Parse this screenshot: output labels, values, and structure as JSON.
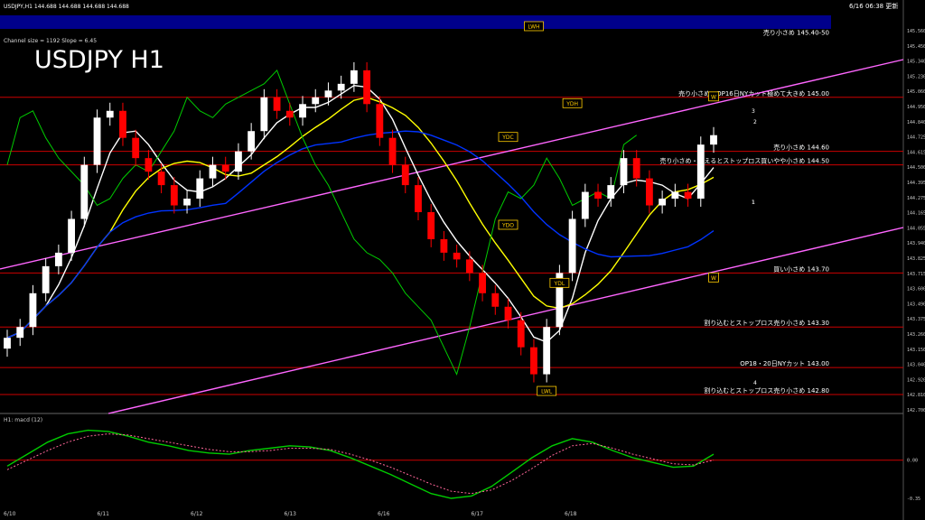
{
  "header": {
    "symbol_line": "USDJPY,H1  144.688 144.688 144.688 144.688",
    "timestamp": "6/16 06:38 更新",
    "channel_info": "Channel size = 1192 Slope = 6.45",
    "big_title": "USDJPY H1"
  },
  "colors": {
    "background": "#000000",
    "candle_up": "#ffffff",
    "candle_down": "#ff0000",
    "sma_fast": "#ffffff",
    "sma_mid": "#ffff00",
    "sma_slow": "#0033ff",
    "channel": "#ff66ff",
    "chikou": "#00cc00",
    "resistance_banner": "#00008b",
    "level_line": "#cc0000",
    "macd_line": "#00cc00",
    "macd_signal": "#ff6699"
  },
  "chart_data": {
    "type": "candlestick",
    "title": "USDJPY H1",
    "ylim": [
      142.7,
      145.56
    ],
    "y_ticks": [
      "145.560",
      "145.450",
      "145.340",
      "145.230",
      "145.060",
      "144.950",
      "144.840",
      "144.725",
      "144.615",
      "144.500",
      "144.395",
      "144.275",
      "144.165",
      "144.055",
      "143.940",
      "143.825",
      "143.715",
      "143.600",
      "143.490",
      "143.375",
      "143.260",
      "143.150",
      "143.040",
      "142.920",
      "142.810",
      "142.700"
    ],
    "x_labels": [
      "6/10",
      "6/11",
      "6/12",
      "6/13",
      "6/16",
      "6/17",
      "6/18"
    ],
    "close": [
      143.22,
      143.3,
      143.55,
      143.75,
      143.85,
      144.1,
      144.5,
      144.85,
      144.9,
      144.7,
      144.55,
      144.45,
      144.35,
      144.2,
      144.25,
      144.4,
      144.5,
      144.45,
      144.6,
      144.75,
      145.0,
      144.9,
      144.85,
      144.95,
      145.0,
      145.05,
      145.1,
      145.2,
      144.95,
      144.7,
      144.5,
      144.35,
      144.15,
      143.95,
      143.85,
      143.8,
      143.7,
      143.55,
      143.45,
      143.35,
      143.15,
      142.95,
      143.3,
      143.7,
      144.1,
      144.3,
      144.25,
      144.35,
      144.55,
      144.4,
      144.2,
      144.25,
      144.3,
      144.25,
      144.65,
      144.72
    ],
    "levels": [
      {
        "label": "売り小さめ 145.40-50",
        "value": 145.45
      },
      {
        "label": "売り小さめ、OP16日NYカット極めて大きめ 145.00",
        "value": 145.0
      },
      {
        "label": "売り小さめ 144.60",
        "value": 144.6
      },
      {
        "label": "売り小さめ・超えるとストップロス買いやや小さめ 144.50",
        "value": 144.5
      },
      {
        "label": "買い小さめ 143.70",
        "value": 143.7
      },
      {
        "label": "割り込むとストップロス売り小さめ 143.30",
        "value": 143.3
      },
      {
        "label": "OP18・20日NYカット 143.00",
        "value": 143.0
      },
      {
        "label": "割り込むとストップロス売り小さめ 142.80",
        "value": 142.8
      }
    ],
    "markers": [
      {
        "label": "LWH",
        "value": 145.52,
        "index": 41
      },
      {
        "label": "YDH",
        "value": 144.95,
        "index": 44
      },
      {
        "label": "YDC",
        "value": 144.7,
        "index": 39
      },
      {
        "label": "YDO",
        "value": 144.05,
        "index": 39
      },
      {
        "label": "YDL",
        "value": 143.62,
        "index": 43
      },
      {
        "label": "LWL",
        "value": 142.82,
        "index": 42
      },
      {
        "label": "W",
        "value": 145.0,
        "index": 55
      },
      {
        "label": "W",
        "value": 143.66,
        "index": 55
      }
    ],
    "channel_numbers": [
      "1",
      "2",
      "3",
      "4",
      "1"
    ],
    "macd": {
      "label": "H1: macd (12)",
      "y_ticks": [
        "0.00",
        "-0.35"
      ],
      "line": [
        -0.05,
        0.05,
        0.15,
        0.22,
        0.25,
        0.24,
        0.2,
        0.15,
        0.12,
        0.08,
        0.06,
        0.05,
        0.08,
        0.1,
        0.12,
        0.11,
        0.08,
        0.02,
        -0.05,
        -0.12,
        -0.2,
        -0.28,
        -0.32,
        -0.3,
        -0.22,
        -0.1,
        0.02,
        0.12,
        0.18,
        0.15,
        0.08,
        0.02,
        -0.02,
        -0.06,
        -0.05,
        0.05
      ],
      "signal": [
        -0.08,
        0.0,
        0.08,
        0.15,
        0.2,
        0.22,
        0.21,
        0.18,
        0.15,
        0.12,
        0.09,
        0.07,
        0.07,
        0.08,
        0.1,
        0.1,
        0.09,
        0.05,
        0.0,
        -0.06,
        -0.13,
        -0.2,
        -0.26,
        -0.28,
        -0.25,
        -0.17,
        -0.07,
        0.04,
        0.12,
        0.14,
        0.1,
        0.05,
        0.01,
        -0.03,
        -0.04,
        0.0
      ]
    }
  }
}
